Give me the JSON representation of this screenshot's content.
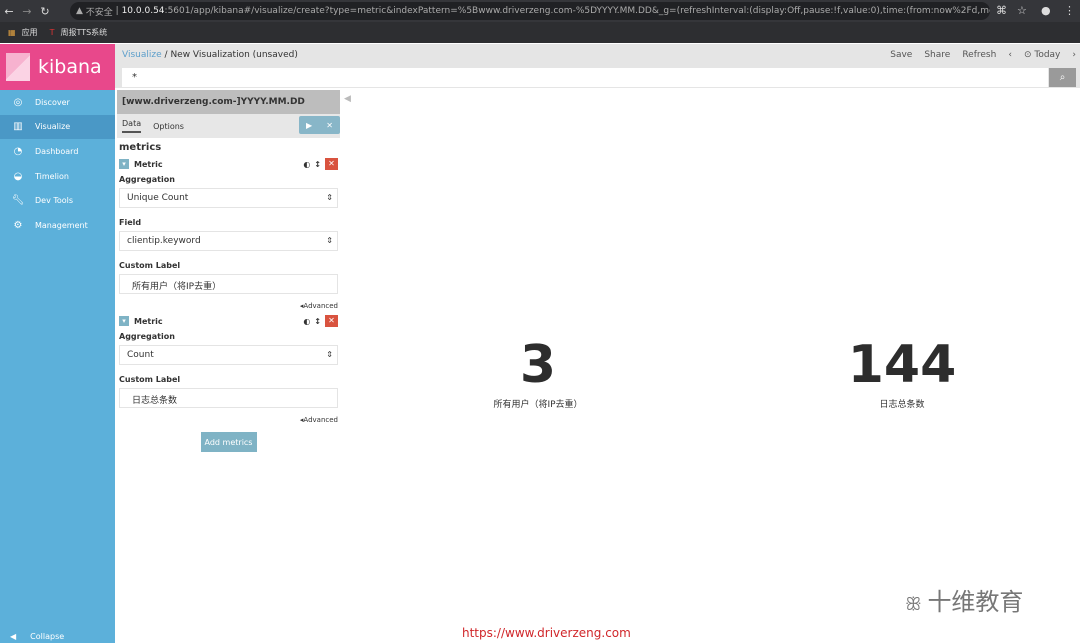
{
  "browser": {
    "insecure": "不安全",
    "url_host": "10.0.0.54",
    "url_rest": ":5601/app/kibana#/visualize/create?type=metric&indexPattern=%5Bwww.driverzeng.com-%5DYYYY.MM.DD&_g=(refreshInterval:(display:Off,pause:!f,value:0),time:(from:now%2Fd,mode:qui...",
    "bookmarks": [
      "应用",
      "周报TTS系统"
    ]
  },
  "sidebar": {
    "brand": "kibana",
    "items": [
      {
        "label": "Discover",
        "icon": "compass-icon"
      },
      {
        "label": "Visualize",
        "icon": "bar-chart-icon"
      },
      {
        "label": "Dashboard",
        "icon": "dashboard-icon"
      },
      {
        "label": "Timelion",
        "icon": "timelion-icon"
      },
      {
        "label": "Dev Tools",
        "icon": "wrench-icon"
      },
      {
        "label": "Management",
        "icon": "gear-icon"
      }
    ],
    "active": "Visualize",
    "collapse": "Collapse"
  },
  "header": {
    "breadcrumb_root": "Visualize",
    "breadcrumb_sep": "/",
    "title": "New Visualization (unsaved)",
    "save": "Save",
    "share": "Share",
    "refresh": "Refresh",
    "time": "Today",
    "query": "*"
  },
  "editor": {
    "index": "[www.driverzeng.com-]YYYY.MM.DD",
    "tabs": [
      "Data",
      "Options"
    ],
    "section": "metrics",
    "metrics": [
      {
        "title": "Metric",
        "aggregation_label": "Aggregation",
        "aggregation": "Unique Count",
        "field_label": "Field",
        "field": "clientip.keyword",
        "custom_label_label": "Custom Label",
        "custom_label": "所有用户（将IP去重）",
        "advanced": "Advanced"
      },
      {
        "title": "Metric",
        "aggregation_label": "Aggregation",
        "aggregation": "Count",
        "custom_label_label": "Custom Label",
        "custom_label": "日志总条数",
        "advanced": "Advanced"
      }
    ],
    "add_metrics": "Add metrics"
  },
  "visualization": {
    "metrics": [
      {
        "value": "3",
        "label": "所有用户（将IP去重）"
      },
      {
        "value": "144",
        "label": "日志总条数"
      }
    ]
  },
  "watermark": {
    "url": "https://www.driverzeng.com",
    "brand": "十维教育"
  },
  "colors": {
    "logo": "#e8488b",
    "sidebar": "#5cb0da",
    "sidebar_active": "#4a98c6",
    "delete": "#d9533f"
  }
}
